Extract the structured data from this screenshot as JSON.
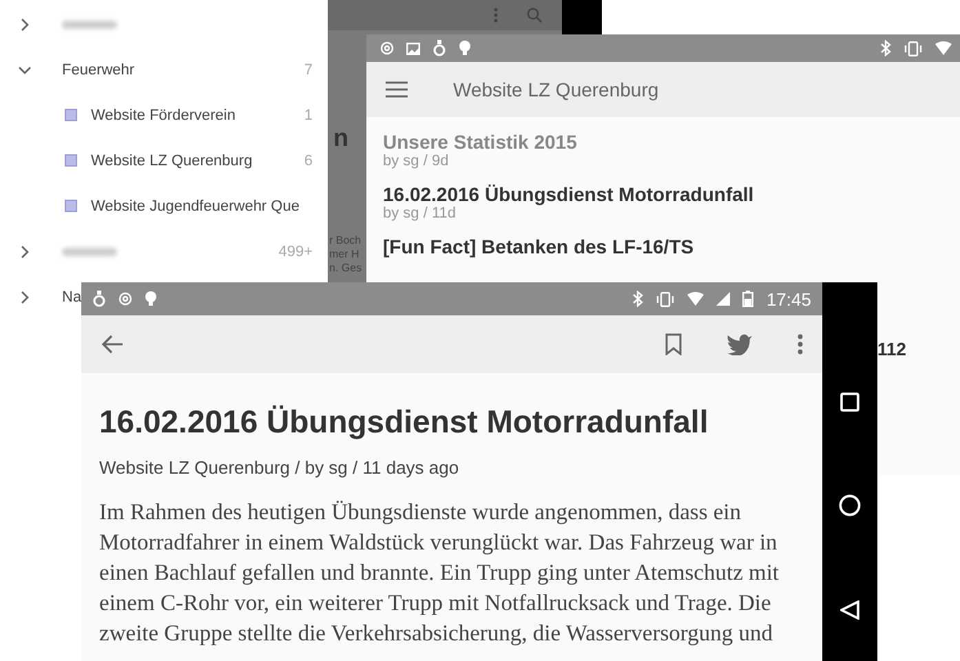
{
  "drawer": {
    "groups": [
      {
        "expanded": false
      },
      {
        "label": "Feuerwehr",
        "count": "7",
        "expanded": true,
        "children": [
          {
            "label": "Website Förderverein",
            "count": "1"
          },
          {
            "label": "Website LZ Querenburg",
            "count": "6"
          },
          {
            "label": "Website Jugendfeuerwehr Que"
          }
        ]
      },
      {
        "count": "499+",
        "expanded": false
      },
      {
        "label": "Na",
        "expanded": false
      }
    ]
  },
  "background_screen": {
    "fragments": [
      "n",
      "r Boch",
      "mer H",
      "n. Ges"
    ]
  },
  "feed_screen": {
    "title": "Website LZ Querenburg",
    "posts": [
      {
        "title": "Unsere Statistik 2015",
        "meta": "by sg / 9d",
        "read": true
      },
      {
        "title": "16.02.2016 Übungsdienst Motorradunfall",
        "meta": "by sg / 11d",
        "read": false
      },
      {
        "title": "[Fun Fact] Betanken des LF-16/TS",
        "read": false
      }
    ],
    "fragment": "112"
  },
  "article_screen": {
    "status_time": "17:45",
    "title": "16.02.2016 Übungsdienst Motorradunfall",
    "meta": "Website LZ Querenburg / by sg / 11 days ago",
    "body_lines": [
      "Im Rahmen des heutigen Übungsdienste wurde angenommen, dass ein",
      "Motorradfahrer in einem Waldstück verunglückt war. Das Fahrzeug war in",
      "einen Bachlauf gefallen und brannte. Ein Trupp ging unter Atemschutz mit",
      "einem C-Rohr vor, ein weiterer Trupp mit Notfallrucksack und Trage. Die",
      "zweite Gruppe stellte die Verkehrsabsicherung, die Wasserversorgung und"
    ]
  }
}
